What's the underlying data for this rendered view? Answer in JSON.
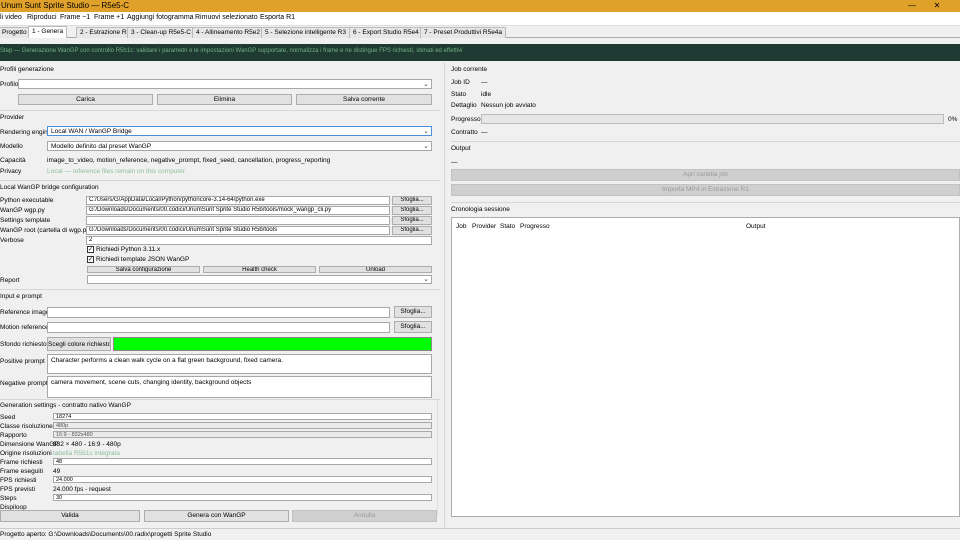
{
  "window": {
    "title": "Unum Sunt Sprite Studio — R5e5-C",
    "minimize": "—",
    "close": "✕"
  },
  "menu": [
    "li video",
    "Riproduci",
    "Frame −1",
    "Frame +1",
    "Aggiungi fotogramma",
    "Rimuovi selezionato",
    "Esporta R1"
  ],
  "tabs": [
    "Progetto",
    "1 - Genera",
    "2 - Estrazione R1",
    "3 - Clean-up R5e5-C",
    "4 - Allineamento R5e2",
    "5 - Selezione intelligente R3",
    "6 - Export Studio R5e4",
    "7 - Preset Produttivi R5e4a"
  ],
  "active_tab": 1,
  "banner": "Step — Generazione WanGP con controllo R5b1c: validare i parametri e le impostazioni WanGP supportate, normalizza i frame e ne distingue FPS richiesti, stimati ed effettivi",
  "profiles": {
    "section": "Profili generazione",
    "profile_label": "Profilo",
    "profile_value": "",
    "load": "Carica",
    "delete": "Elimina",
    "save_current": "Salva corrente"
  },
  "provider": {
    "section": "Provider",
    "engine_label": "Rendering engine",
    "engine_value": "Local WAN / WanGP Bridge",
    "model_label": "Modello",
    "model_value": "Modello definito dal preset WanGP",
    "capacity_label": "Capacità",
    "capacity_value": "image_to_video, motion_reference, negative_prompt, fixed_seed, cancellation, progress_reporting",
    "privacy_label": "Privacy",
    "privacy_value": "Local — reference files remain on this computer."
  },
  "bridge": {
    "section": "Local WanGP bridge configuration",
    "python_label": "Python executable",
    "python_value": "C:/Users/G/AppData/Local/Python/pythoncore-3.14-64/python.exe",
    "wgp_label": "WanGP wgp.py",
    "wgp_value": "G:/Downloads/Documents/00.codici/UnumSunt Sprite Studio R5b/tools/mock_wangp_cli.py",
    "settings_label": "Settings template",
    "settings_value": "",
    "root_label": "WanGP root (cartella di wgp.py)",
    "root_value": "G:/Downloads/Documents/00.codici/UnumSunt Sprite Studio R5b/tools",
    "browse": "Sfoglia...",
    "verbose_label": "Verbose",
    "verbose_value": "2",
    "require_python": "Richiedi Python 3.11.x",
    "require_template": "Richiedi template JSON WanGP",
    "save_config": "Salva configurazione",
    "health_check": "Health check",
    "unload": "Unload",
    "report_label": "Report",
    "report_value": ""
  },
  "input": {
    "section": "Input e prompt",
    "ref_image_label": "Reference image",
    "ref_image_value": "",
    "motion_ref_label": "Motion reference",
    "motion_ref_value": "",
    "browse": "Sfoglia...",
    "bg_label": "Sfondo richiesto",
    "bg_button": "Scegli colore richiesto",
    "bg_color": "#00ff00",
    "positive_label": "Positive prompt",
    "positive_value": "Character performs a clean walk cycle on a flat green background, fixed camera.",
    "negative_label": "Negative prompt",
    "negative_value": "camera movement, scene cuts, changing identity, background objects"
  },
  "generation": {
    "section": "Generation settings - contratto nativo WanGP",
    "seed_label": "Seed",
    "seed_value": "18274",
    "res_class_label": "Classe risoluzione",
    "res_class_value": "480p",
    "ratio_label": "Rapporto",
    "ratio_value": "16:9 - 832x480",
    "dimension_label": "Dimensione WanGP",
    "dimension_value": "832 × 480 - 16:9 - 480p",
    "origin_label": "Origine risoluzioni",
    "origin_value": "tabella R5b1c integrata",
    "frames_req_label": "Frame richiesti",
    "frames_req_value": "48",
    "frames_exec_label": "Frame eseguiti",
    "frames_exec_value": "49",
    "fps_req_label": "FPS richiesti",
    "fps_req_value": "24.000",
    "fps_est_label": "FPS previsti",
    "fps_est_value": "24.000 fps - request",
    "steps_label": "Steps",
    "steps_value": "30",
    "disp_label": "Dispiloop",
    "disp_value": ""
  },
  "actions": {
    "validate": "Valida",
    "generate": "Genera con WanGP",
    "cancel": "Annulla"
  },
  "job": {
    "section": "Job corrente",
    "id_label": "Job ID",
    "id_value": "—",
    "state_label": "Stato",
    "state_value": "idle",
    "detail_label": "Dettaglio",
    "detail_value": "Nessun job avviato",
    "progress_label": "Progresso",
    "progress_text": "0%",
    "progress_fraction": 0,
    "contract_label": "Contratto",
    "contract_value": "—"
  },
  "output": {
    "section": "Output",
    "value": "—",
    "open_folder": "Apri cartella job",
    "import_mp4": "Importa MP4 in Estrazione R1"
  },
  "history": {
    "section": "Cronologia sessione",
    "columns": [
      "Job",
      "Provider",
      "Stato",
      "Progresso",
      "Output"
    ]
  },
  "status": "Progetto aperto: G:\\Downloads\\Documents\\00.radix\\progetti Sprite Studio"
}
